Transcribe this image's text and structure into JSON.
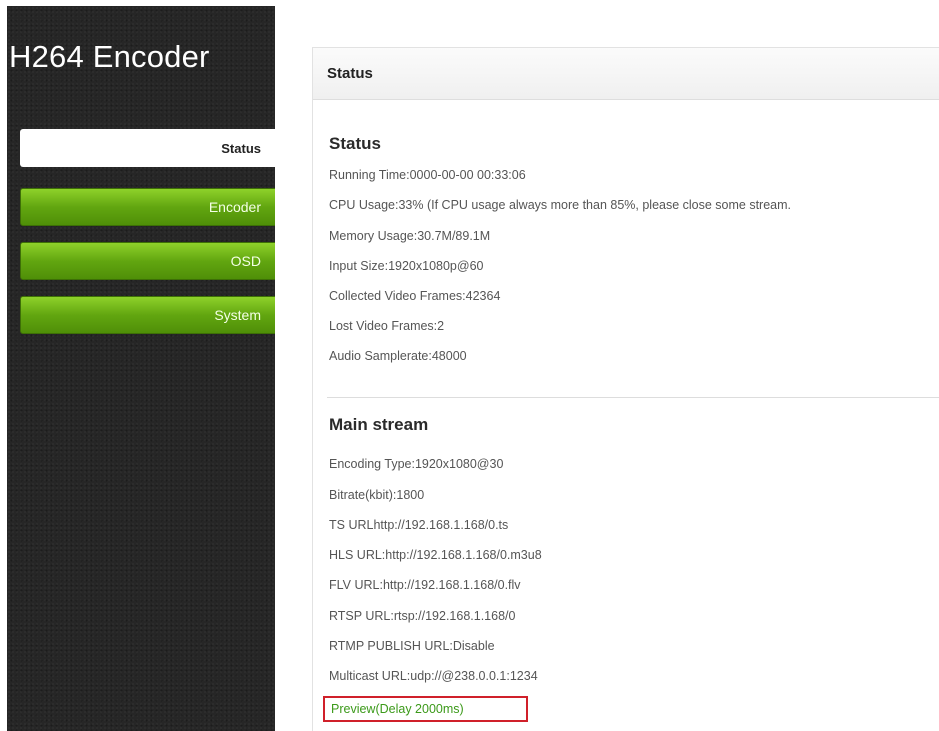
{
  "sidebar": {
    "brand": "H264 Encoder",
    "items": [
      {
        "label": "Status"
      },
      {
        "label": "Encoder"
      },
      {
        "label": "OSD"
      },
      {
        "label": "System"
      }
    ]
  },
  "panel": {
    "header": "Status",
    "status": {
      "title": "Status",
      "lines": [
        "Running Time:0000-00-00 00:33:06",
        "CPU Usage:33% (If CPU usage always more than 85%, please close some stream.",
        "Memory Usage:30.7M/89.1M",
        "Input Size:1920x1080p@60",
        "Collected Video Frames:42364",
        "Lost Video Frames:2",
        "Audio Samplerate:48000"
      ]
    },
    "main_stream": {
      "title": "Main stream",
      "lines": [
        "Encoding Type:1920x1080@30",
        "Bitrate(kbit):1800",
        "TS URLhttp://192.168.1.168/0.ts",
        "HLS URL:http://192.168.1.168/0.m3u8",
        "FLV URL:http://192.168.1.168/0.flv",
        "RTSP URL:rtsp://192.168.1.168/0",
        "RTMP PUBLISH URL:Disable",
        "Multicast URL:udp://@238.0.0.1:1234"
      ],
      "preview": "Preview(Delay 2000ms)"
    }
  },
  "colors": {
    "sidebar_bg": "#262626",
    "nav_green": "#62a610",
    "preview_text": "#3c9a1a",
    "highlight_border": "#d0202a"
  }
}
